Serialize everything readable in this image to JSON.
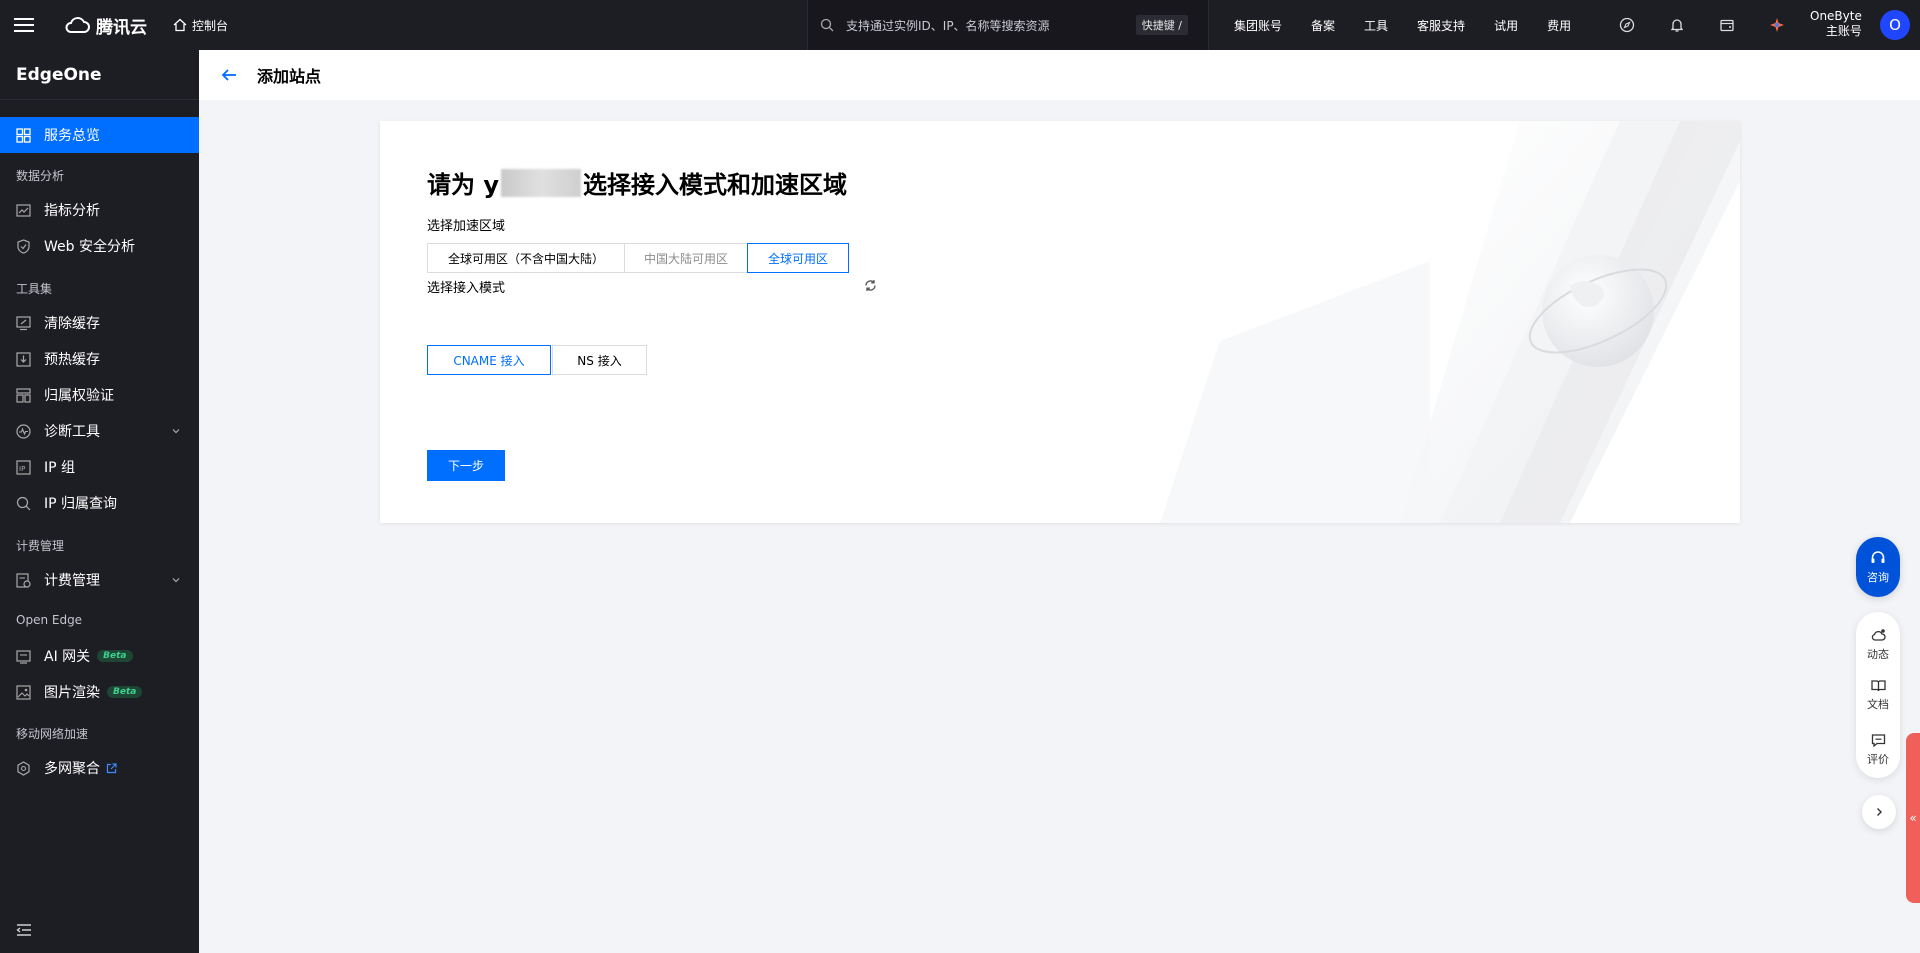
{
  "topbar": {
    "brand": "腾讯云",
    "console": "控制台",
    "search_placeholder": "支持通过实例ID、IP、名称等搜索资源",
    "shortcut": "快捷键 /",
    "links": [
      "集团账号",
      "备案",
      "工具",
      "客服支持",
      "试用",
      "费用"
    ],
    "account_name": "OneByte",
    "account_role": "主账号",
    "avatar_letter": "O"
  },
  "sidebar": {
    "title": "EdgeOne",
    "overview": "服务总览",
    "group_data": "数据分析",
    "metrics": "指标分析",
    "web_security": "Web 安全分析",
    "group_tools": "工具集",
    "purge_cache": "清除缓存",
    "prefetch_cache": "预热缓存",
    "ownership": "归属权验证",
    "diagnostics": "诊断工具",
    "ip_group": "IP 组",
    "ip_lookup": "IP 归属查询",
    "group_billing": "计费管理",
    "billing": "计费管理",
    "group_open_edge": "Open Edge",
    "ai_gateway": "AI 网关",
    "image_render": "图片渲染",
    "beta": "Beta",
    "group_mobile": "移动网络加速",
    "multi_net": "多网聚合"
  },
  "page": {
    "title": "添加站点"
  },
  "card": {
    "heading_prefix": "请为 y",
    "heading_suffix": "选择接入模式和加速区域",
    "region_label": "选择加速区域",
    "regions": [
      "全球可用区（不含中国大陆）",
      "中国大陆可用区",
      "全球可用区"
    ],
    "mode_label": "选择接入模式",
    "modes": [
      "CNAME 接入",
      "NS 接入"
    ],
    "next_label": "下一步"
  },
  "floating": {
    "consult": "咨询",
    "news": "动态",
    "docs": "文档",
    "review": "评价",
    "collapse_glyph": "«"
  }
}
